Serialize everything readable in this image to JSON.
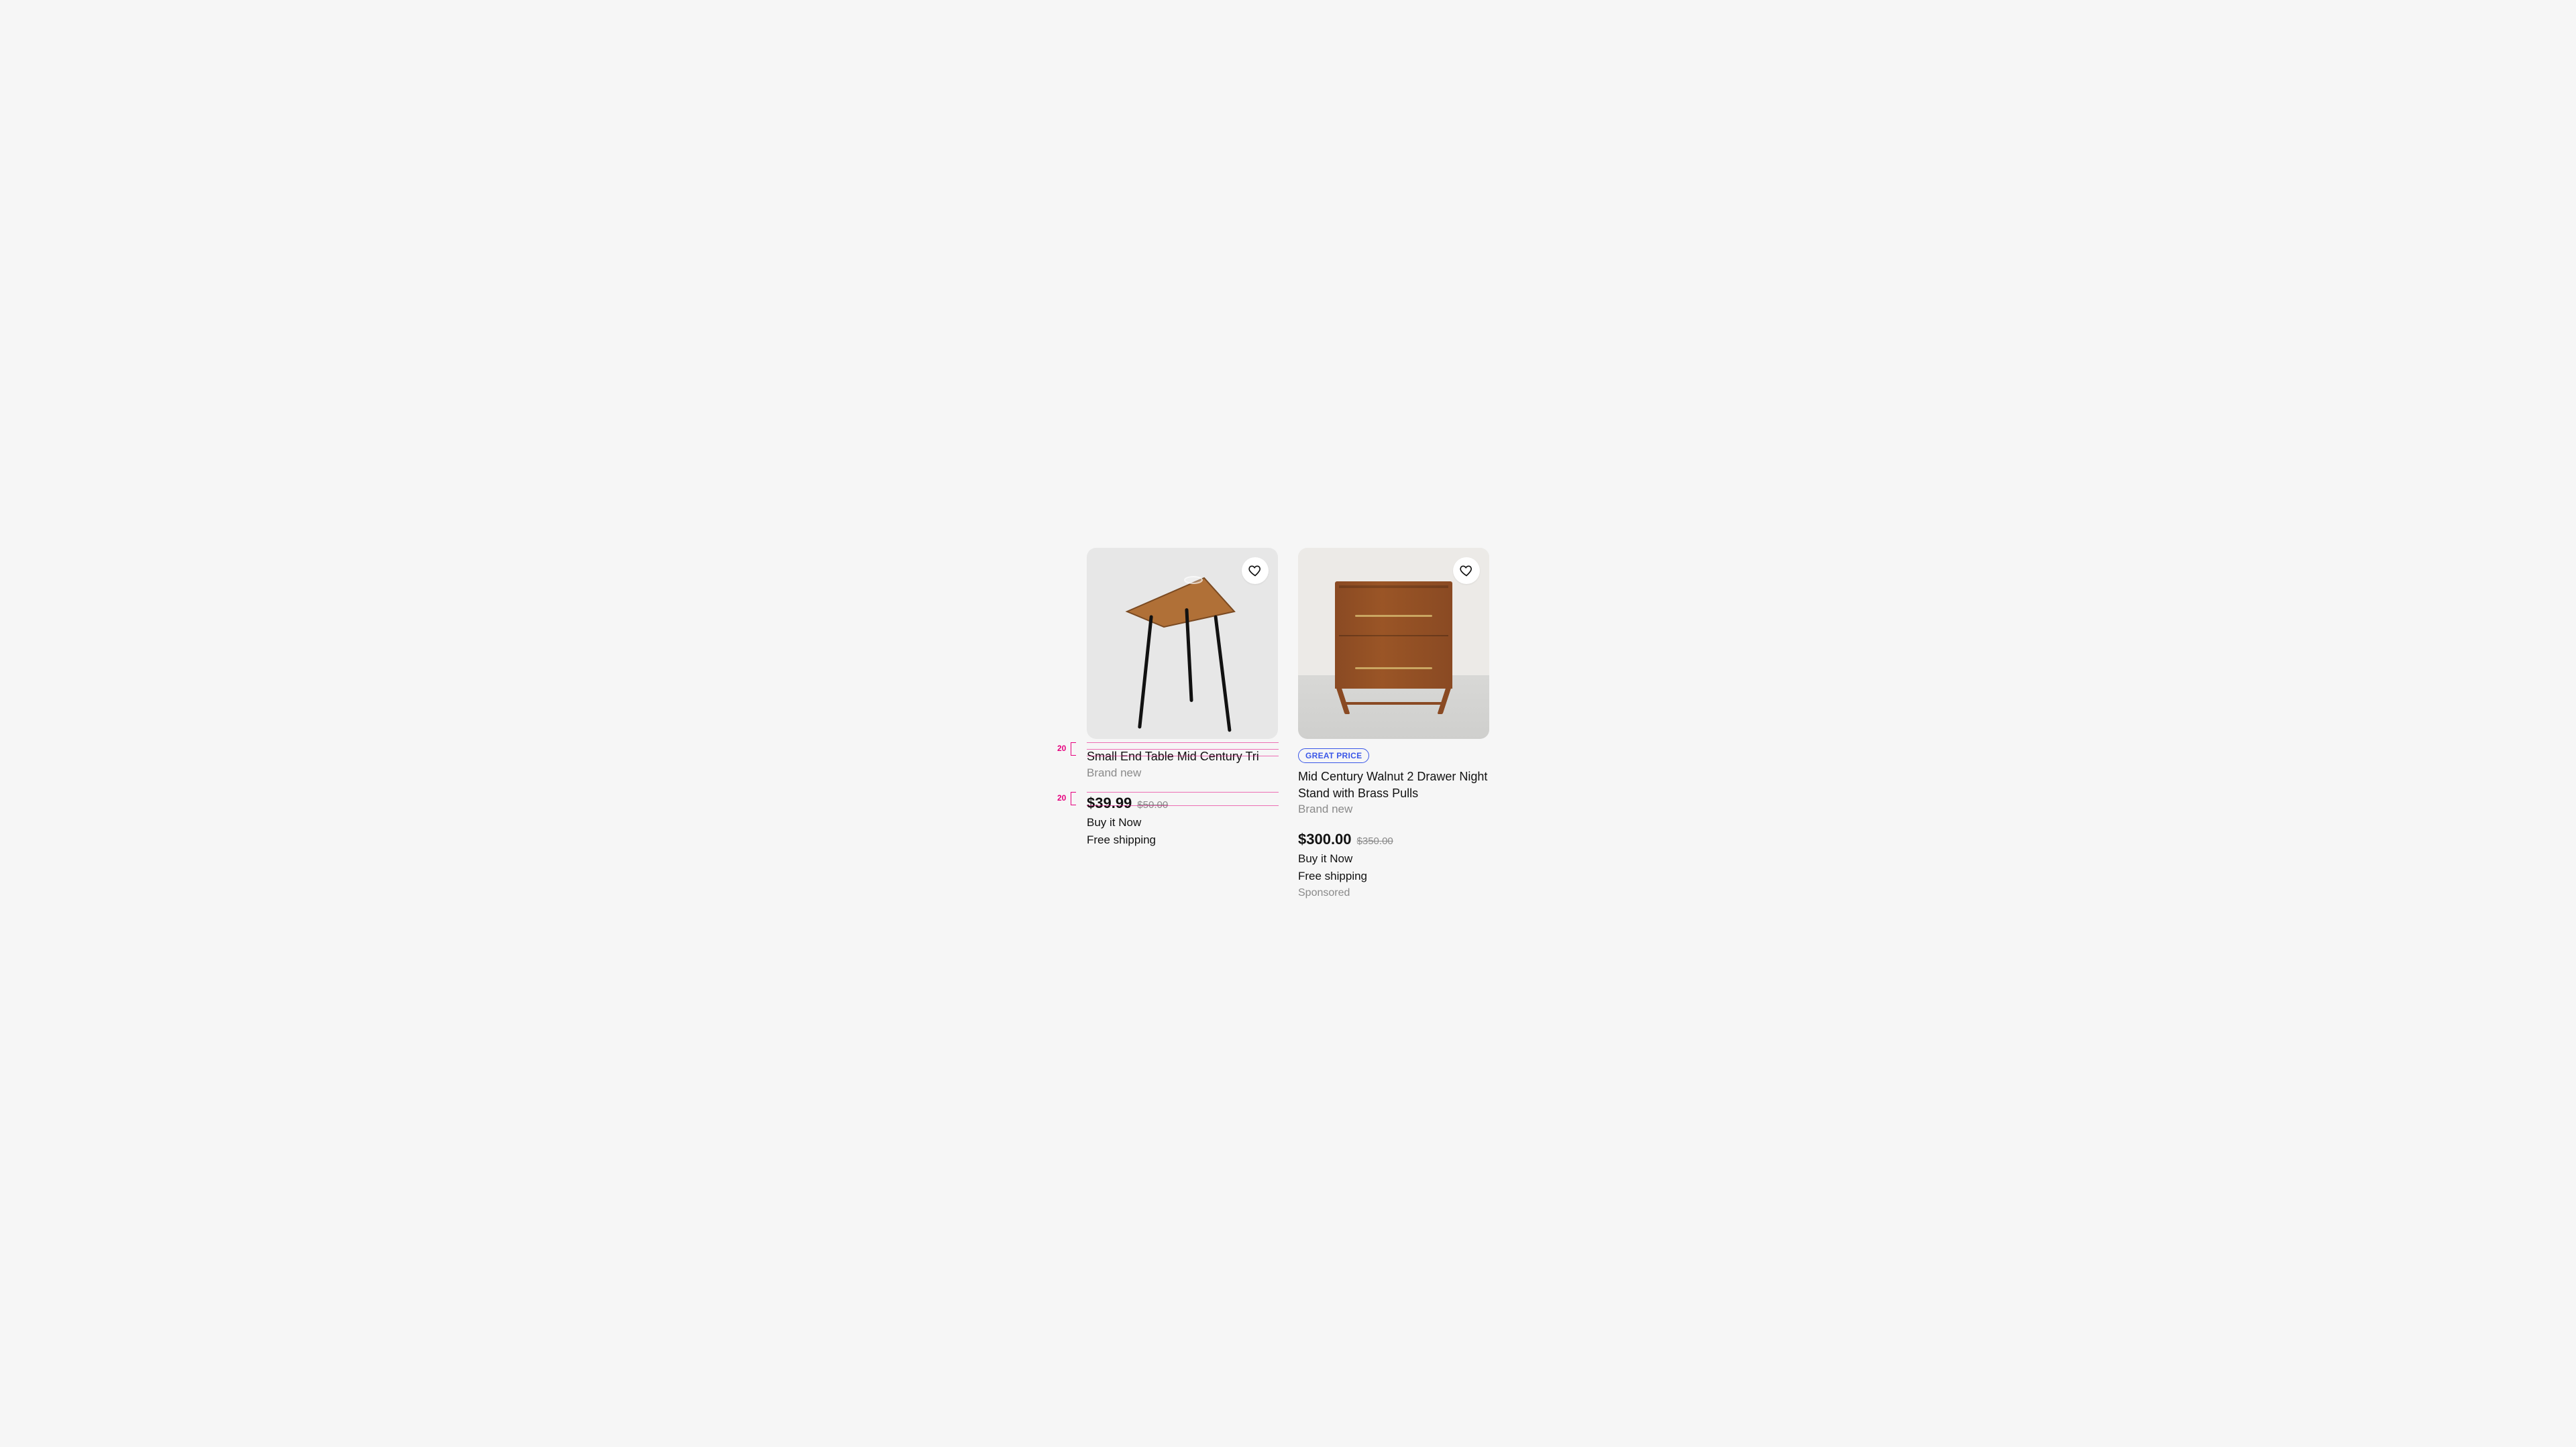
{
  "annotations": {
    "gap_top": "20",
    "gap_mid": "20"
  },
  "products": [
    {
      "badge": null,
      "title": "Small End Table Mid Century Tri",
      "condition": "Brand new",
      "price": "$39.99",
      "old_price": "$50.00",
      "purchase": "Buy it Now",
      "shipping": "Free shipping",
      "sponsored": null
    },
    {
      "badge": "GREAT PRICE",
      "title": "Mid Century Walnut 2 Drawer Night Stand with Brass Pulls",
      "condition": "Brand new",
      "price": "$300.00",
      "old_price": "$350.00",
      "purchase": "Buy it Now",
      "shipping": "Free shipping",
      "sponsored": "Sponsored"
    }
  ]
}
